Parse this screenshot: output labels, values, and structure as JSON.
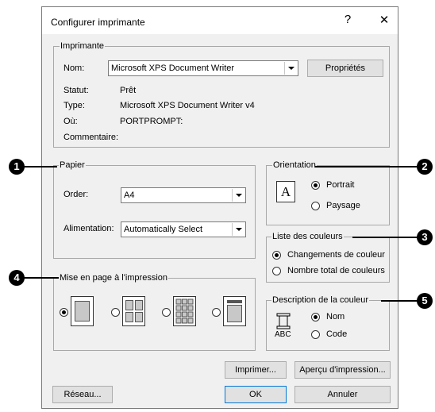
{
  "window": {
    "title": "Configurer imprimante",
    "help_glyph": "?",
    "close_glyph": "✕"
  },
  "printer": {
    "legend": "Imprimante",
    "name_label": "Nom:",
    "name_value": "Microsoft XPS Document Writer",
    "properties_button": "Propriétés",
    "status_label": "Statut:",
    "status_value": "Prêt",
    "type_label": "Type:",
    "type_value": "Microsoft XPS Document Writer v4",
    "where_label": "Où:",
    "where_value": "PORTPROMPT:",
    "comment_label": "Commentaire:"
  },
  "paper": {
    "legend": "Papier",
    "size_label": "Order:",
    "size_value": "A4",
    "source_label": "Alimentation:",
    "source_value": "Automatically Select"
  },
  "orientation": {
    "legend": "Orientation",
    "icon_letter": "A",
    "portrait_label": "Portrait",
    "landscape_label": "Paysage",
    "selected": "portrait"
  },
  "color_list": {
    "legend": "Liste des couleurs",
    "option_changes": "Changements de couleur",
    "option_total": "Nombre total de couleurs",
    "selected": "changes"
  },
  "layout": {
    "legend": "Mise en page à l'impression",
    "options": [
      "single-page",
      "four-pages",
      "many-pages",
      "page-with-list"
    ],
    "selected": "single-page"
  },
  "color_description": {
    "legend": "Description de la couleur",
    "icon_text": "ABC",
    "option_name": "Nom",
    "option_code": "Code",
    "selected": "name"
  },
  "buttons": {
    "print": "Imprimer...",
    "preview": "Aperçu d'impression...",
    "network": "Réseau...",
    "ok": "OK",
    "cancel": "Annuler"
  },
  "callouts": [
    "1",
    "2",
    "3",
    "4",
    "5"
  ]
}
